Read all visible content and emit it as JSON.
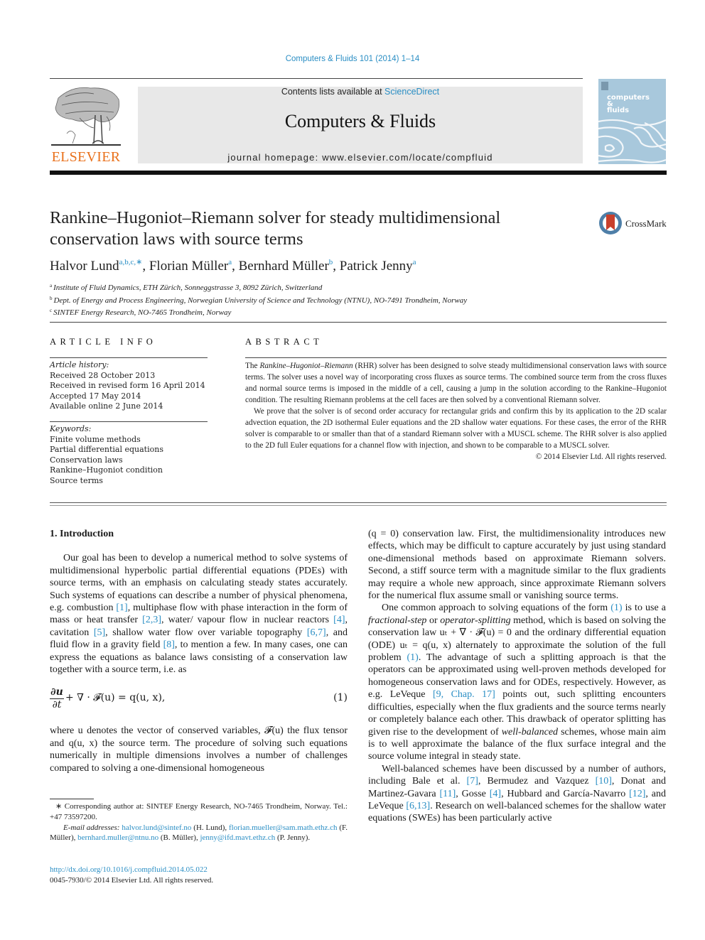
{
  "running_head": "Computers & Fluids 101 (2014) 1–14",
  "banner": {
    "contents_prefix": "Contents lists available at ",
    "contents_link": "ScienceDirect",
    "journal_title": "Computers & Fluids",
    "homepage": "journal homepage: www.elsevier.com/locate/compfluid"
  },
  "publisher_logo": {
    "label": "ELSEVIER",
    "color": "#e9711c"
  },
  "cover": {
    "line1": "computers",
    "line2": "&",
    "line3": "fluids"
  },
  "crossmark": {
    "label": "CrossMark"
  },
  "article": {
    "title": "Rankine–Hugoniot–Riemann solver for steady multidimensional conservation laws with source terms",
    "authors": [
      {
        "name": "Halvor Lund",
        "sup": "a,b,c,∗"
      },
      {
        "name": "Florian Müller",
        "sup": "a"
      },
      {
        "name": "Bernhard Müller",
        "sup": "b"
      },
      {
        "name": "Patrick Jenny",
        "sup": "a"
      }
    ],
    "affiliations": [
      {
        "key": "a",
        "text": "Institute of Fluid Dynamics, ETH Zürich, Sonneggstrasse 3, 8092 Zürich, Switzerland"
      },
      {
        "key": "b",
        "text": "Dept. of Energy and Process Engineering, Norwegian University of Science and Technology (NTNU), NO-7491 Trondheim, Norway"
      },
      {
        "key": "c",
        "text": "SINTEF Energy Research, NO-7465 Trondheim, Norway"
      }
    ]
  },
  "article_info": {
    "heading": "ARTICLE INFO",
    "history_label": "Article history:",
    "history": [
      "Received 28 October 2013",
      "Received in revised form 16 April 2014",
      "Accepted 17 May 2014",
      "Available online 2 June 2014"
    ],
    "keywords_label": "Keywords:",
    "keywords": [
      "Finite volume methods",
      "Partial differential equations",
      "Conservation laws",
      "Rankine–Hugoniot condition",
      "Source terms"
    ]
  },
  "abstract": {
    "heading": "ABSTRACT",
    "p1_pre": "The ",
    "p1_italic": "Rankine–Hugoniot–Riemann",
    "p1_post": " (RHR) solver has been designed to solve steady multidimensional conservation laws with source terms. The solver uses a novel way of incorporating cross fluxes as source terms. The combined source term from the cross fluxes and normal source terms is imposed in the middle of a cell, causing a jump in the solution according to the Rankine–Hugoniot condition. The resulting Riemann problems at the cell faces are then solved by a conventional Riemann solver.",
    "p2": "We prove that the solver is of second order accuracy for rectangular grids and confirm this by its application to the 2D scalar advection equation, the 2D isothermal Euler equations and the 2D shallow water equations. For these cases, the error of the RHR solver is comparable to or smaller than that of a standard Riemann solver with a MUSCL scheme. The RHR solver is also applied to the 2D full Euler equations for a channel flow with injection, and shown to be comparable to a MUSCL solver.",
    "copyright": "© 2014 Elsevier Ltd. All rights reserved."
  },
  "body": {
    "section_heading": "1. Introduction",
    "left_p1": [
      {
        "t": "Our goal has been to develop a numerical method to solve systems of multidimensional hyperbolic partial differential equations (PDEs) with source terms, with an emphasis on calculating steady states accurately. Such systems of equations can describe a number of physical phenomena, e.g. combustion "
      },
      {
        "ref": "[1]"
      },
      {
        "t": ", multiphase flow with phase interaction in the form of mass or heat transfer "
      },
      {
        "ref": "[2,3]"
      },
      {
        "t": ", water/ vapour flow in nuclear reactors "
      },
      {
        "ref": "[4]"
      },
      {
        "t": ", cavitation "
      },
      {
        "ref": "[5]"
      },
      {
        "t": ", shallow water flow over variable topography "
      },
      {
        "ref": "[6,7]"
      },
      {
        "t": ", and fluid flow in a gravity field "
      },
      {
        "ref": "[8]"
      },
      {
        "t": ", to mention a few. In many cases, one can express the equations as balance laws consisting of a conservation law together with a source term, i.e. as"
      }
    ],
    "equation": {
      "numerator": "∂u",
      "denominator": "∂t",
      "body": "+ ∇ · 𝓕(u) = q(u, x),",
      "number": "(1)"
    },
    "left_p2": "where u denotes the vector of conserved variables, 𝓕(u) the flux tensor and q(u, x) the source term. The procedure of solving such equations numerically in multiple dimensions involves a number of challenges compared to solving a one-dimensional homogeneous",
    "right_p1": "(q = 0) conservation law. First, the multidimensionality introduces new effects, which may be difficult to capture accurately by just using standard one-dimensional methods based on approximate Riemann solvers. Second, a stiff source term with a magnitude similar to the flux gradients may require a whole new approach, since approximate Riemann solvers for the numerical flux assume small or vanishing source terms.",
    "right_p2": [
      {
        "t": "One common approach to solving equations of the form "
      },
      {
        "ref": "(1)"
      },
      {
        "t": " is to use a "
      },
      {
        "i": "fractional-step"
      },
      {
        "t": " or "
      },
      {
        "i": "operator-splitting"
      },
      {
        "t": " method, which is based on solving the conservation law uₜ + ∇ · 𝓕(u) = 0 and the ordinary differential equation (ODE) uₜ = q(u, x) alternately to approximate the solution of the full problem "
      },
      {
        "ref": "(1)"
      },
      {
        "t": ". The advantage of such a splitting approach is that the operators can be approximated using well-proven methods developed for homogeneous conservation laws and for ODEs, respectively. However, as e.g. LeVeque "
      },
      {
        "ref": "[9, Chap. 17]"
      },
      {
        "t": " points out, such splitting encounters difficulties, especially when the flux gradients and the source terms nearly or completely balance each other. This drawback of operator splitting has given rise to the development of "
      },
      {
        "i": "well-balanced"
      },
      {
        "t": " schemes, whose main aim is to well approximate the balance of the flux surface integral and the source volume integral in steady state."
      }
    ],
    "right_p3": [
      {
        "t": "Well-balanced schemes have been discussed by a number of authors, including Bale et al. "
      },
      {
        "ref": "[7]"
      },
      {
        "t": ", Bermudez and Vazquez "
      },
      {
        "ref": "[10]"
      },
      {
        "t": ", Donat and Martinez-Gavara "
      },
      {
        "ref": "[11]"
      },
      {
        "t": ", Gosse "
      },
      {
        "ref": "[4]"
      },
      {
        "t": ", Hubbard and García-Navarro "
      },
      {
        "ref": "[12]"
      },
      {
        "t": ", and LeVeque "
      },
      {
        "ref": "[6,13]"
      },
      {
        "t": ". Research on well-balanced schemes for the shallow water equations (SWEs) has been particularly active"
      }
    ]
  },
  "footnotes": {
    "corresponding": "∗ Corresponding author at: SINTEF Energy Research, NO-7465 Trondheim, Norway. Tel.: +47 73597200.",
    "email_label": "E-mail addresses:",
    "emails": [
      {
        "addr": "halvor.lund@sintef.no",
        "who": " (H. Lund), "
      },
      {
        "addr": "florian.mueller@sam.math.ethz.ch",
        "who": " (F. Müller), "
      },
      {
        "addr": "bernhard.muller@ntnu.no",
        "who": " (B. Müller), "
      },
      {
        "addr": "jenny@ifd.mavt.ethz.ch",
        "who": " (P. Jenny)."
      }
    ],
    "doi": "http://dx.doi.org/10.1016/j.compfluid.2014.05.022",
    "issn": "0045-7930/© 2014 Elsevier Ltd. All rights reserved."
  },
  "colors": {
    "link": "#2a8ec4",
    "elsevier_orange": "#e9711c",
    "banner_bg": "#e8e8e8",
    "cover_bg": "#a8c8dc"
  }
}
